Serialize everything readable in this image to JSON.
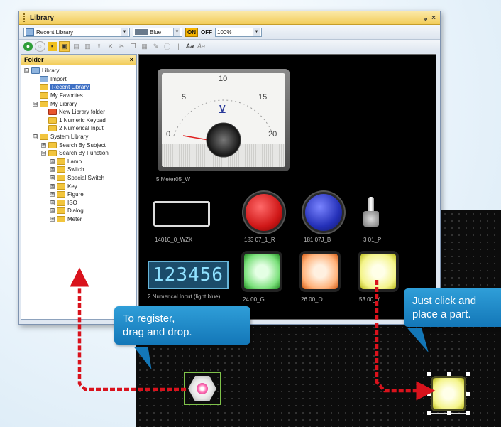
{
  "window": {
    "title": "Library",
    "pin_icon": "pin-icon",
    "close_glyph": "×"
  },
  "toolbar": {
    "library_select": "Recent Library",
    "color_select": "Blue",
    "on_label": "ON",
    "off_label": "OFF",
    "zoom_select": "100%"
  },
  "folder_panel": {
    "title": "Folder",
    "close_glyph": "×",
    "tree": [
      {
        "label": "Library",
        "level": 0,
        "exp": "⊟",
        "icon": "lib"
      },
      {
        "label": "Import",
        "level": 1,
        "exp": "",
        "icon": "lib"
      },
      {
        "label": "Recent Library",
        "level": 1,
        "exp": "",
        "icon": "folder",
        "selected": true
      },
      {
        "label": "My Favorites",
        "level": 1,
        "exp": "",
        "icon": "folder"
      },
      {
        "label": "My Library",
        "level": 1,
        "exp": "⊟",
        "icon": "folder"
      },
      {
        "label": "New Library folder",
        "level": 2,
        "exp": "",
        "icon": "red"
      },
      {
        "label": "1 Numeric Keypad",
        "level": 2,
        "exp": "",
        "icon": "folder"
      },
      {
        "label": "2 Numerical Input",
        "level": 2,
        "exp": "",
        "icon": "folder"
      },
      {
        "label": "System Library",
        "level": 1,
        "exp": "⊟",
        "icon": "folder"
      },
      {
        "label": "Search By Subject",
        "level": 2,
        "exp": "⊞",
        "icon": "folder"
      },
      {
        "label": "Search By Function",
        "level": 2,
        "exp": "⊟",
        "icon": "folder"
      },
      {
        "label": "Lamp",
        "level": 3,
        "exp": "⊞",
        "icon": "folder"
      },
      {
        "label": "Switch",
        "level": 3,
        "exp": "⊞",
        "icon": "folder"
      },
      {
        "label": "Special Switch",
        "level": 3,
        "exp": "⊞",
        "icon": "folder"
      },
      {
        "label": "Key",
        "level": 3,
        "exp": "⊞",
        "icon": "folder"
      },
      {
        "label": "Figure",
        "level": 3,
        "exp": "⊞",
        "icon": "folder"
      },
      {
        "label": "ISO",
        "level": 3,
        "exp": "⊞",
        "icon": "folder"
      },
      {
        "label": "Dialog",
        "level": 3,
        "exp": "⊞",
        "icon": "folder"
      },
      {
        "label": "Meter",
        "level": 3,
        "exp": "⊞",
        "icon": "folder"
      }
    ]
  },
  "preview": {
    "meter": {
      "unit": "V",
      "scale": [
        "0",
        "5",
        "10",
        "15",
        "20"
      ],
      "label": "5 Meter05_W"
    },
    "parts": {
      "frame_label": "14010_0_WZK",
      "red_label": "183 07_1_R",
      "blue_label": "181 07J_B",
      "toggle_label": "3 01_P",
      "digital_value": "123456",
      "digital_label": "2 Numerical Input (light blue)",
      "green_label": "24 00_G",
      "orange_label": "26 00_O",
      "yellow_label": "53 00_Y"
    }
  },
  "callouts": {
    "register": [
      "To register,",
      "drag and drop."
    ],
    "place": [
      "Just click and",
      "place a part."
    ]
  },
  "colors": {
    "accent": "#f2cc5a",
    "callout": "#1b86c6",
    "arrow": "#d9121c"
  }
}
